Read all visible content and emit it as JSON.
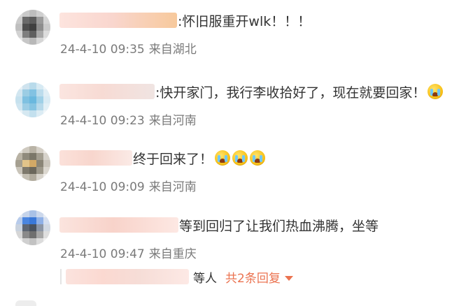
{
  "comments": [
    {
      "text": ":怀旧服重开wlk！！！",
      "time": "24-4-10 09:35",
      "location": "来自湖北",
      "avatar_colors": [
        "#d8d8d8",
        "#c9c9c9",
        "#bdbdbd",
        "#cfcfcf",
        "#e0e0e0",
        "#cbcbcb",
        "#6a6a6a",
        "#5c5c5c",
        "#9a9a9a",
        "#d4d4d4",
        "#bfbfbf",
        "#4e4e4e",
        "#3f3f3f",
        "#8d8d8d",
        "#cacaca",
        "#d2d2d2",
        "#7e7e7e",
        "#5f5f5f",
        "#a9a9a9",
        "#dcdcdc",
        "#e4e4e4",
        "#c7c7c7",
        "#b8b8b8",
        "#d6d6d6",
        "#ebebeb"
      ],
      "name_blur_colors": [
        "#fde4de",
        "#f9d6ce",
        "#f7c99c"
      ],
      "emoji_count": 0
    },
    {
      "text": ":快开家门，我行李收拾好了，现在就要回家！",
      "time": "24-4-10 09:23",
      "location": "来自河南",
      "avatar_colors": [
        "#e8f1f6",
        "#cfe3ee",
        "#b9dbeb",
        "#d7eaf3",
        "#eef5f9",
        "#d2e6f0",
        "#9ccde4",
        "#82c2e2",
        "#bcdcec",
        "#e0eef5",
        "#c6e1ee",
        "#7fc1e1",
        "#6ab8de",
        "#9fd0e7",
        "#d9ebf4",
        "#cfe5f0",
        "#9dcde5",
        "#86c4e2",
        "#b7d9ea",
        "#e3f0f6",
        "#eaf3f8",
        "#d5e8f1",
        "#c3e0ee",
        "#dcecf4",
        "#f1f7fa"
      ],
      "name_blur_colors": [
        "#fbe5e0",
        "#f7dbd4",
        "#f0e4e2"
      ],
      "emoji_count": 1
    },
    {
      "text": "终于回来了！",
      "time": "24-4-10 09:09",
      "location": "来自河南",
      "avatar_colors": [
        "#e6e3dd",
        "#cfcac0",
        "#b9b3a6",
        "#d5d0c7",
        "#ece9e4",
        "#b8b2a4",
        "#8f8a7c",
        "#7b7769",
        "#a39e90",
        "#d7d3cb",
        "#a59f90",
        "#e2c48a",
        "#d2a966",
        "#8a8576",
        "#cbc6bc",
        "#c9c4b9",
        "#7e796c",
        "#6b675b",
        "#9d988a",
        "#dcd8d0",
        "#ebe8e3",
        "#c4bfb3",
        "#b1ab9d",
        "#d8d4cc",
        "#f0eeea"
      ],
      "name_blur_colors": [
        "#fbe1da",
        "#f8d6cd",
        "#fbeae6"
      ],
      "emoji_count": 3
    },
    {
      "text": "等到回归了让我们热血沸腾，坐等",
      "time": "24-4-10 09:47",
      "location": "来自重庆",
      "avatar_colors": [
        "#e2e8f2",
        "#c6d4ea",
        "#a9c1e6",
        "#ccd8ec",
        "#e9eef6",
        "#b7cbeb",
        "#4b86e0",
        "#3a78d8",
        "#8fb0e6",
        "#d5dff0",
        "#c9d2de",
        "#5e6673",
        "#4a525e",
        "#8b95a5",
        "#d1d8e2",
        "#d6d6d6",
        "#8a8a8a",
        "#6f6f6f",
        "#a7a7a7",
        "#dedede",
        "#ececec",
        "#d0d0d0",
        "#c2c2c2",
        "#dcdcdc",
        "#f2f2f2"
      ],
      "name_blur_colors": [
        "#fbe4de",
        "#f8d3ca",
        "#fde8e3"
      ],
      "emoji_count": 0
    }
  ],
  "reply_bar": {
    "suffix": "等人",
    "more_label": "共2条回复"
  }
}
